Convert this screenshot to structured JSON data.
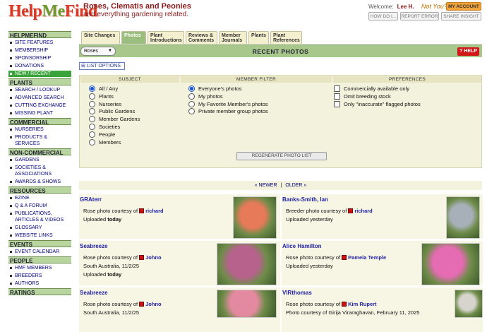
{
  "header": {
    "logo_text_1": "Help",
    "logo_text_2": "Me",
    "logo_text_3": "Find",
    "site_title": "Roses, Clematis and Peonies",
    "site_subtitle": "and everything gardening related.",
    "welcome_label": "Welcome:",
    "user_name": "Lee H.",
    "not_you": "Not You?",
    "my_account": "MY ACCOUNT",
    "how_do_i": "HOW DO I...",
    "report_error": "REPORT ERROR",
    "share_insight": "SHARE INSIGHT"
  },
  "sidebar": {
    "sections": [
      {
        "title": "HELPMEFIND",
        "items": [
          "SITE FEATURES",
          "MEMBERSHIP",
          "SPONSORSHIP",
          "DONATIONS",
          "NEW / RECENT"
        ]
      },
      {
        "title": "PLANTS",
        "items": [
          "SEARCH / LOOKUP",
          "ADVANCED SEARCH",
          "CUTTING EXCHANGE",
          "MISSING PLANT"
        ]
      },
      {
        "title": "COMMERCIAL",
        "items": [
          "NURSERIES",
          "PRODUCTS & SERVICES"
        ]
      },
      {
        "title": "NON-COMMERCIAL",
        "items": [
          "GARDENS",
          "SOCIETIES & ASSOCIATIONS",
          "AWARDS & SHOWS"
        ]
      },
      {
        "title": "RESOURCES",
        "items": [
          "EZINE",
          "Q & A FORUM",
          "PUBLICATIONS, ARTICLES & VIDEOS",
          "GLOSSARY",
          "WEBSITE LINKS"
        ]
      },
      {
        "title": "EVENTS",
        "items": [
          "EVENT CALENDAR"
        ]
      },
      {
        "title": "PEOPLE",
        "items": [
          "HMF MEMBERS",
          "BREEDERS",
          "AUTHORS"
        ]
      },
      {
        "title": "RATINGS",
        "items": []
      }
    ],
    "selected": "NEW / RECENT"
  },
  "tabs": [
    "Site Changes",
    "Photos",
    "Plant Introductions",
    "Reviews & Comments",
    "Member Journals",
    "Plants",
    "Plant References"
  ],
  "active_tab": "Photos",
  "titlebar": {
    "select_value": "Roses",
    "title": "Recent Photos",
    "help": "HELP"
  },
  "list_options": "LIST OPTIONS",
  "filters": {
    "subject_header": "SUBJECT",
    "member_header": "MEMBER FILTER",
    "prefs_header": "PREFERENCES",
    "subject_options": [
      "All / Any",
      "Plants",
      "Nurseries",
      "Public Gardens",
      "Member Gardens",
      "Societies",
      "People",
      "Members"
    ],
    "subject_selected": "All / Any",
    "member_options": [
      "Everyone's photos",
      "My photos",
      "My Favorite Member's photos",
      "Private member group photos"
    ],
    "member_selected": "Everyone's photos",
    "prefs_options": [
      "Commercially available only",
      "Omit breeding stock",
      "Only \"inaccurate\" flagged photos"
    ],
    "regenerate": "REGENERATE PHOTO LIST"
  },
  "pager": {
    "newer": "« NEWER",
    "sep": "|",
    "older": "OLDER »"
  },
  "cards": [
    {
      "name": "GRAterr",
      "line1_prefix": "Rose photo courtesy of",
      "line1_user": "richard",
      "line2": "Uploaded",
      "line2_bold": "today",
      "line3": "",
      "photo_color": "#e77a58"
    },
    {
      "name": "Banks-Smith, Ian",
      "line1_prefix": "Breeder photo courtesy of",
      "line1_user": "richard",
      "line2": "Uploaded yesterday",
      "line2_bold": "",
      "line3": "",
      "photo_color": "#a7b0b8"
    },
    {
      "name": "Seabreeze",
      "line1_prefix": "Rose photo courtesy of",
      "line1_user": "Johno",
      "line2": "South Australia, 11/2/25",
      "line2_bold": "",
      "line3": "Uploaded",
      "line3_bold": "today",
      "photo_color": "#b7628d"
    },
    {
      "name": "Alice Hamilton",
      "line1_prefix": "Rose photo courtesy of",
      "line1_user": "Pamela Temple",
      "line2": "Uploaded yesterday",
      "line2_bold": "",
      "line3": "",
      "photo_color": "#e56bb2"
    },
    {
      "name": "Seabreeze",
      "line1_prefix": "Rose photo courtesy of",
      "line1_user": "Johno",
      "line2": "South Australia, 11/2/25",
      "line2_bold": "",
      "line3": "",
      "photo_color": "#e48aa0"
    },
    {
      "name": "VIRthomas",
      "line1_prefix": "Rose photo courtesy of",
      "line1_user": "Kim Rupert",
      "line2": "Photo courtesy of Girija Viraraghavan, February 11, 2025",
      "line2_bold": "",
      "line3": "",
      "photo_color": "#d6d4cc"
    }
  ]
}
